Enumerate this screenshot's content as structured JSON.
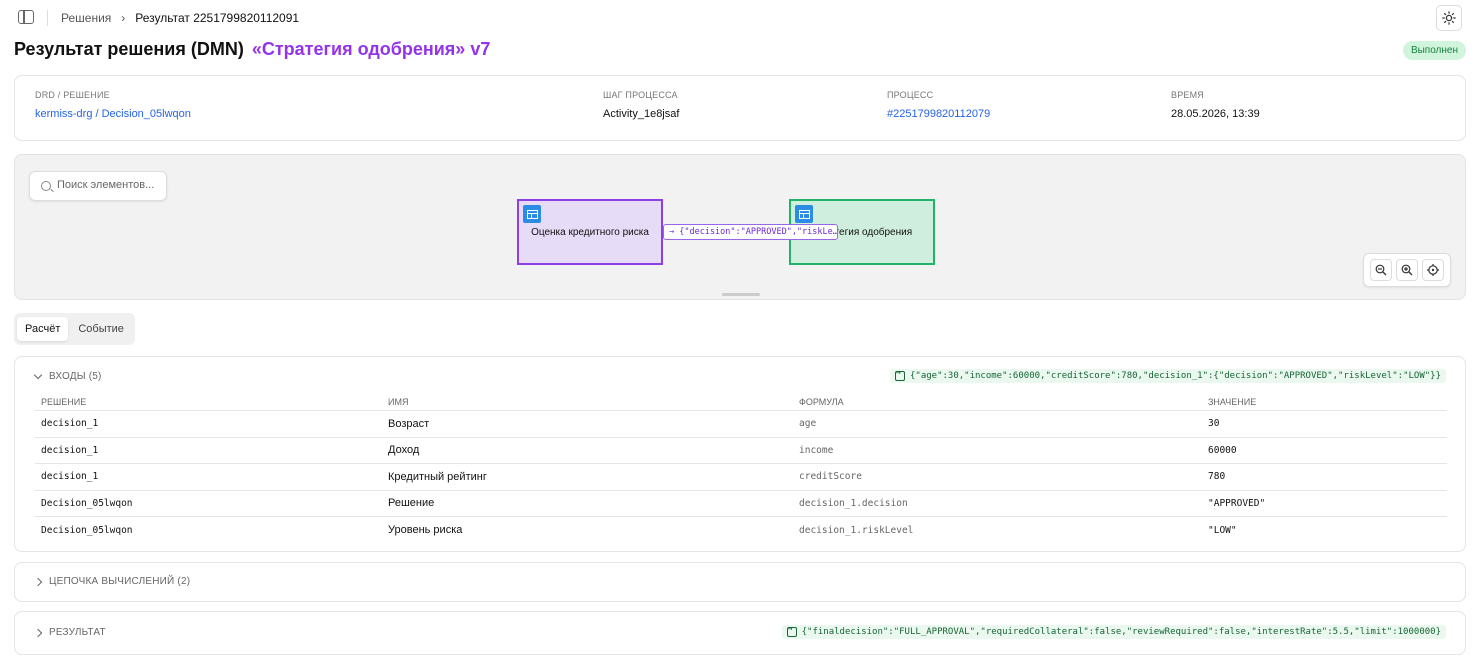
{
  "breadcrumb": {
    "root": "Решения",
    "sep": "›",
    "current": "Результат 2251799820112091"
  },
  "title": {
    "main": "Результат решения (DMN)",
    "accent": "«Стратегия одобрения» v7"
  },
  "status": "Выполнен",
  "info": {
    "drd_label": "DRD / РЕШЕНИЕ",
    "drd_value": "kermiss-drg / Decision_05lwqon",
    "step_label": "ШАГ ПРОЦЕССА",
    "step_value": "Activity_1e8jsaf",
    "process_label": "ПРОЦЕСС",
    "process_value": "#2251799820112079",
    "time_label": "ВРЕМЯ",
    "time_value": "28.05.2026, 13:39"
  },
  "diagram": {
    "search_placeholder": "Поиск элементов...",
    "node_risk": "Оценка кредитного риска",
    "node_approval": "Стратегия одобрения",
    "edge_label": "→ {\"decision\":\"APPROVED\",\"riskLe…"
  },
  "tabs": {
    "calc": "Расчёт",
    "event": "Событие"
  },
  "inputs": {
    "header": "ВХОДЫ (5)",
    "json": "{\"age\":30,\"income\":60000,\"creditScore\":780,\"decision_1\":{\"decision\":\"APPROVED\",\"riskLevel\":\"LOW\"}}",
    "columns": [
      "РЕШЕНИЕ",
      "ИМЯ",
      "ФОРМУЛА",
      "ЗНАЧЕНИЕ"
    ],
    "rows": [
      {
        "decision": "decision_1",
        "name": "Возраст",
        "formula": "age",
        "value": "30"
      },
      {
        "decision": "decision_1",
        "name": "Доход",
        "formula": "income",
        "value": "60000"
      },
      {
        "decision": "decision_1",
        "name": "Кредитный рейтинг",
        "formula": "creditScore",
        "value": "780"
      },
      {
        "decision": "Decision_05lwqon",
        "name": "Решение",
        "formula": "decision_1.decision",
        "value": "\"APPROVED\""
      },
      {
        "decision": "Decision_05lwqon",
        "name": "Уровень риска",
        "formula": "decision_1.riskLevel",
        "value": "\"LOW\""
      }
    ]
  },
  "chain": {
    "header": "ЦЕПОЧКА ВЫЧИСЛЕНИЙ (2)"
  },
  "result": {
    "header": "РЕЗУЛЬТАТ",
    "json": "{\"finaldecision\":\"FULL_APPROVAL\",\"requiredCollateral\":false,\"reviewRequired\":false,\"interestRate\":5.5,\"limit\":1000000}"
  },
  "colors": {
    "accent": "#9333ea",
    "link": "#2563eb",
    "success_bg": "#d1f5dc",
    "success_text": "#15803d"
  }
}
